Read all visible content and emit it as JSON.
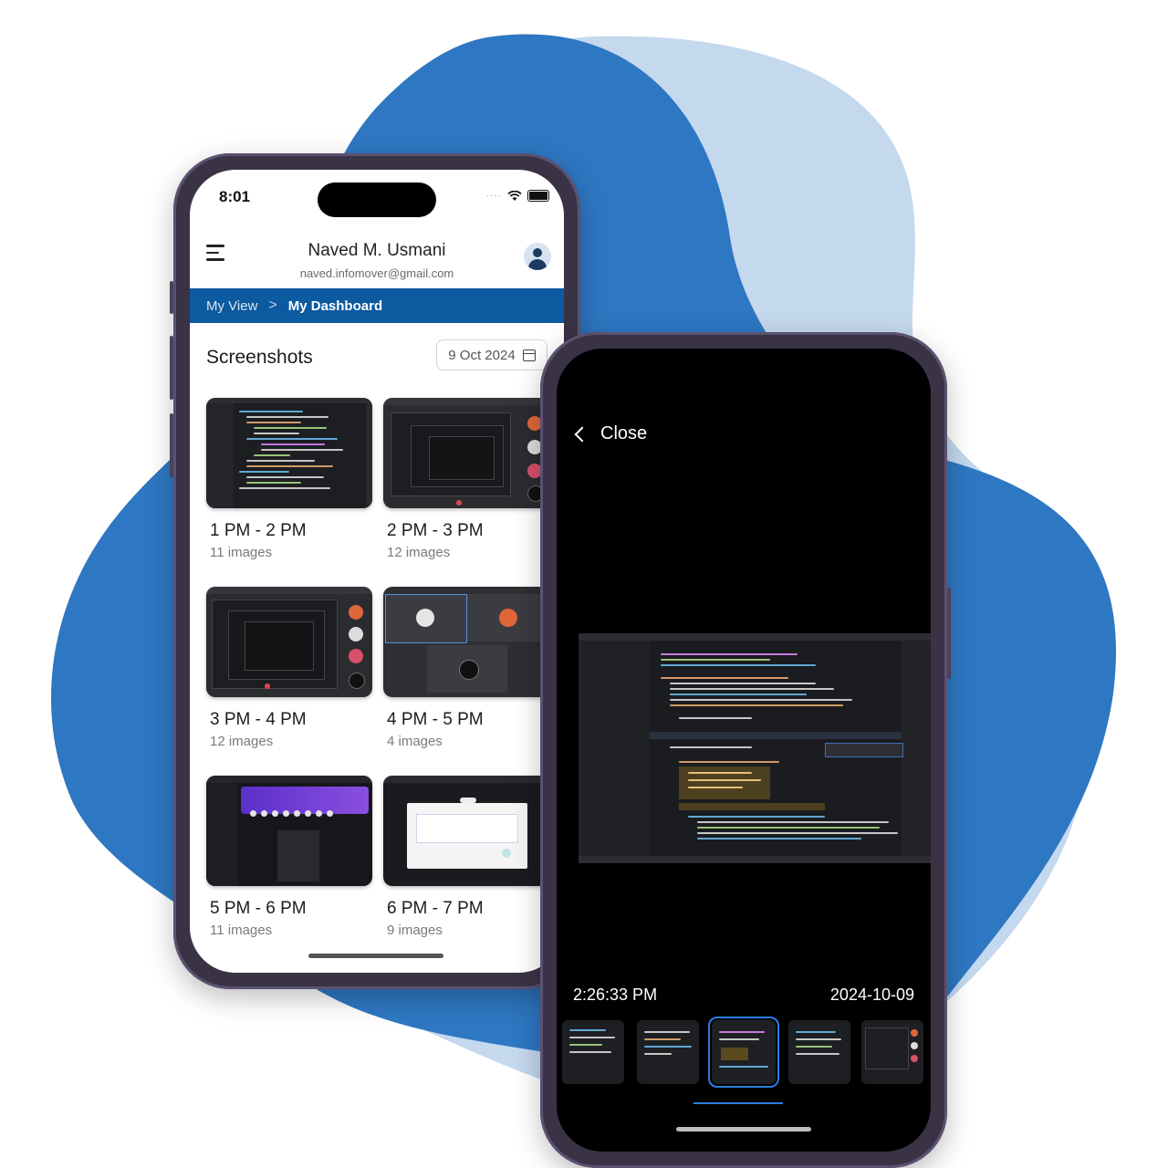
{
  "colors": {
    "brand_blue": "#0c5aa0",
    "blob_dark": "#2e77c2",
    "blob_light": "#c4d8ee",
    "selected_outline": "#2a7de1"
  },
  "phone1": {
    "status": {
      "time": "8:01"
    },
    "header": {
      "menu_icon": "hamburger-icon",
      "user_name": "Naved M. Usmani",
      "user_email": "naved.infomover@gmail.com",
      "avatar_icon": "user-avatar-icon"
    },
    "breadcrumb": {
      "parent": "My View",
      "separator": ">",
      "current": "My Dashboard"
    },
    "screenshots": {
      "title": "Screenshots",
      "date": "9 Oct 2024",
      "date_icon": "calendar-icon",
      "groups": [
        {
          "label": "1 PM - 2 PM",
          "count": "11 images"
        },
        {
          "label": "2 PM - 3 PM",
          "count": "12 images"
        },
        {
          "label": "3 PM - 4 PM",
          "count": "12 images"
        },
        {
          "label": "4 PM - 5 PM",
          "count": "4 images"
        },
        {
          "label": "5 PM - 6 PM",
          "count": "11 images"
        },
        {
          "label": "6 PM - 7 PM",
          "count": "9 images"
        }
      ]
    }
  },
  "phone2": {
    "close_label": "Close",
    "close_icon": "chevron-left-icon",
    "time": "2:26:33 PM",
    "date": "2024-10-09",
    "thumbnail_count": "5",
    "selected_thumbnail": "3"
  }
}
